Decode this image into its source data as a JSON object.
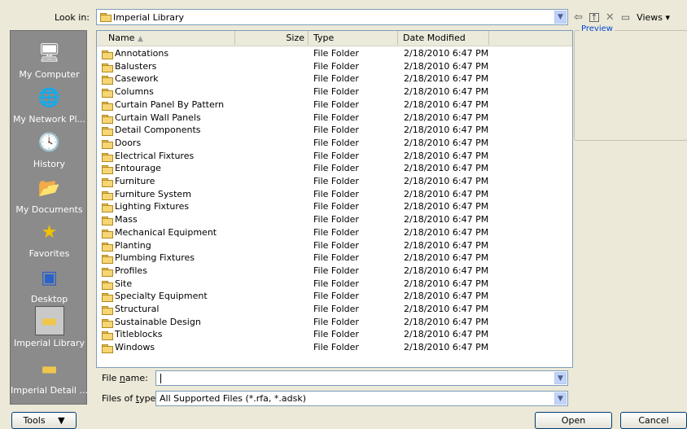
{
  "lookin": {
    "label": "Look in:",
    "value": "Imperial Library"
  },
  "toolbar": {
    "views_label": "Views",
    "icons": [
      "back-icon",
      "up-folder-icon",
      "delete-icon",
      "new-folder-icon",
      "views-icon"
    ]
  },
  "preview": {
    "label": "Preview"
  },
  "places": [
    {
      "label": "My Computer",
      "icon": "computer-icon"
    },
    {
      "label": "My Network Pl...",
      "icon": "network-icon"
    },
    {
      "label": "History",
      "icon": "history-icon"
    },
    {
      "label": "My Documents",
      "icon": "documents-icon"
    },
    {
      "label": "Favorites",
      "icon": "star-icon"
    },
    {
      "label": "Desktop",
      "icon": "desktop-icon"
    },
    {
      "label": "Imperial Library",
      "icon": "folder-icon"
    },
    {
      "label": "Imperial Detail ...",
      "icon": "folder-icon"
    }
  ],
  "columns": {
    "name": "Name",
    "size": "Size",
    "type": "Type",
    "date": "Date Modified"
  },
  "files": [
    {
      "name": "Annotations",
      "type": "File Folder",
      "date": "2/18/2010 6:47 PM"
    },
    {
      "name": "Balusters",
      "type": "File Folder",
      "date": "2/18/2010 6:47 PM"
    },
    {
      "name": "Casework",
      "type": "File Folder",
      "date": "2/18/2010 6:47 PM"
    },
    {
      "name": "Columns",
      "type": "File Folder",
      "date": "2/18/2010 6:47 PM"
    },
    {
      "name": "Curtain Panel By Pattern",
      "type": "File Folder",
      "date": "2/18/2010 6:47 PM"
    },
    {
      "name": "Curtain Wall Panels",
      "type": "File Folder",
      "date": "2/18/2010 6:47 PM"
    },
    {
      "name": "Detail Components",
      "type": "File Folder",
      "date": "2/18/2010 6:47 PM"
    },
    {
      "name": "Doors",
      "type": "File Folder",
      "date": "2/18/2010 6:47 PM"
    },
    {
      "name": "Electrical Fixtures",
      "type": "File Folder",
      "date": "2/18/2010 6:47 PM"
    },
    {
      "name": "Entourage",
      "type": "File Folder",
      "date": "2/18/2010 6:47 PM"
    },
    {
      "name": "Furniture",
      "type": "File Folder",
      "date": "2/18/2010 6:47 PM"
    },
    {
      "name": "Furniture System",
      "type": "File Folder",
      "date": "2/18/2010 6:47 PM"
    },
    {
      "name": "Lighting Fixtures",
      "type": "File Folder",
      "date": "2/18/2010 6:47 PM"
    },
    {
      "name": "Mass",
      "type": "File Folder",
      "date": "2/18/2010 6:47 PM"
    },
    {
      "name": "Mechanical Equipment",
      "type": "File Folder",
      "date": "2/18/2010 6:47 PM"
    },
    {
      "name": "Planting",
      "type": "File Folder",
      "date": "2/18/2010 6:47 PM"
    },
    {
      "name": "Plumbing Fixtures",
      "type": "File Folder",
      "date": "2/18/2010 6:47 PM"
    },
    {
      "name": "Profiles",
      "type": "File Folder",
      "date": "2/18/2010 6:47 PM"
    },
    {
      "name": "Site",
      "type": "File Folder",
      "date": "2/18/2010 6:47 PM"
    },
    {
      "name": "Specialty Equipment",
      "type": "File Folder",
      "date": "2/18/2010 6:47 PM"
    },
    {
      "name": "Structural",
      "type": "File Folder",
      "date": "2/18/2010 6:47 PM"
    },
    {
      "name": "Sustainable Design",
      "type": "File Folder",
      "date": "2/18/2010 6:47 PM"
    },
    {
      "name": "Titleblocks",
      "type": "File Folder",
      "date": "2/18/2010 6:47 PM"
    },
    {
      "name": "Windows",
      "type": "File Folder",
      "date": "2/18/2010 6:47 PM"
    }
  ],
  "filename": {
    "label": "File name:",
    "value": ""
  },
  "filetype": {
    "label": "Files of type:",
    "value": "All Supported Files  (*.rfa,  *.adsk)"
  },
  "buttons": {
    "tools": "Tools",
    "open": "Open",
    "cancel": "Cancel"
  }
}
